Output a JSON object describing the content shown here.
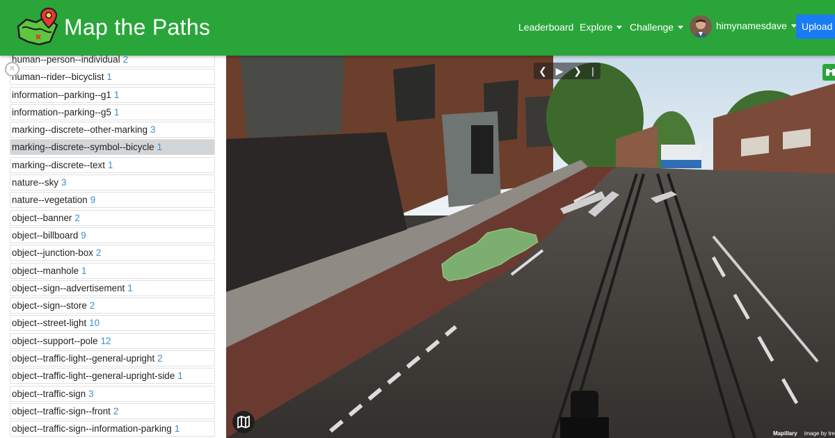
{
  "header": {
    "title": "Map the Paths",
    "logo_icon": "map-pin-logo-icon",
    "nav": {
      "leaderboard": "Leaderboard",
      "explore": "Explore",
      "challenge": "Challenge",
      "username": "himynamesdave"
    },
    "upload_label": "Upload I",
    "colors": {
      "header_bg": "#2aa53a",
      "upload_bg": "#1a7cf2"
    }
  },
  "sidebar": {
    "close_icon": "close-icon",
    "labels": [
      {
        "name": "human--person--individual",
        "count": "2"
      },
      {
        "name": "human--rider--bicyclist",
        "count": "1"
      },
      {
        "name": "information--parking--g1",
        "count": "1"
      },
      {
        "name": "information--parking--g5",
        "count": "1"
      },
      {
        "name": "marking--discrete--other-marking",
        "count": "3"
      },
      {
        "name": "marking--discrete--symbol--bicycle",
        "count": "1",
        "selected": true
      },
      {
        "name": "marking--discrete--text",
        "count": "1"
      },
      {
        "name": "nature--sky",
        "count": "3"
      },
      {
        "name": "nature--vegetation",
        "count": "9"
      },
      {
        "name": "object--banner",
        "count": "2"
      },
      {
        "name": "object--billboard",
        "count": "9"
      },
      {
        "name": "object--junction-box",
        "count": "2"
      },
      {
        "name": "object--manhole",
        "count": "1"
      },
      {
        "name": "object--sign--advertisement",
        "count": "1"
      },
      {
        "name": "object--sign--store",
        "count": "2"
      },
      {
        "name": "object--street-light",
        "count": "10"
      },
      {
        "name": "object--support--pole",
        "count": "12"
      },
      {
        "name": "object--traffic-light--general-upright",
        "count": "2"
      },
      {
        "name": "object--traffic-light--general-upright-side",
        "count": "1"
      },
      {
        "name": "object--traffic-sign",
        "count": "3"
      },
      {
        "name": "object--traffic-sign--front",
        "count": "2"
      },
      {
        "name": "object--traffic-sign--information-parking",
        "count": "1"
      }
    ]
  },
  "viewer": {
    "controls": {
      "prev": "❮",
      "play": "▶",
      "next": "❯",
      "stop": "|"
    },
    "map_icon": "map-icon",
    "binoculars_icon": "binoculars-icon",
    "attribution": {
      "brand": "Mapillary",
      "credit": "image by tre"
    },
    "highlight_color": "#7fc47a"
  }
}
